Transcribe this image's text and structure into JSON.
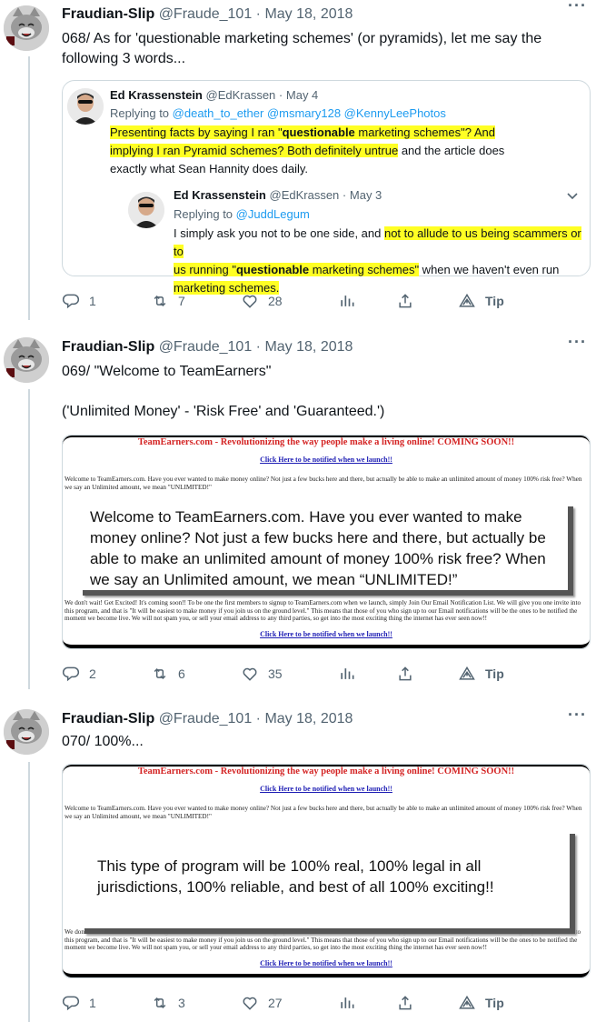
{
  "tweets": [
    {
      "author_name": "Fraudian-Slip",
      "author_handle": "@Fraude_101",
      "separator": "·",
      "date": "May 18, 2018",
      "more_label": "···",
      "text": "068/ As for 'questionable marketing schemes' (or pyramids), let me say the following 3 words...",
      "quote": {
        "author_name": "Ed Krassenstein",
        "author_handle": "@EdKrassen",
        "date": "May 4",
        "replying_prefix": "Replying to",
        "replying_to": "@death_to_ether @msmary128 @KennyLeePhotos",
        "text_hl_1a": "Presenting facts by saying I ran \"",
        "text_hl_1b": "questionable",
        "text_hl_1c": " marketing schemes\"? And",
        "text_hl_2": "implying I ran Pyramid schemes?  Both definitely untrue",
        "text_2_rest": " and the article does",
        "text_3": "exactly what Sean Hannity does daily.",
        "nested": {
          "author_name": "Ed Krassenstein",
          "author_handle": "@EdKrassen",
          "date": "May 3",
          "replying_prefix": "Replying to",
          "replying_to": "@JuddLegum",
          "text_1a": "I simply ask you not to be one side, and ",
          "text_1b": "not to allude to us being scammers or to",
          "text_2a": "us running \"",
          "text_2b": "questionable",
          "text_2c": " marketing schemes\"",
          "text_2d": " when we haven't even run",
          "text_3": "marketing schemes."
        }
      },
      "replies": "1",
      "retweets": "7",
      "likes": "28",
      "tip_label": "Tip"
    },
    {
      "author_name": "Fraudian-Slip",
      "author_handle": "@Fraude_101",
      "separator": "·",
      "date": "May 18, 2018",
      "more_label": "···",
      "text_line1": "069/ \"Welcome to TeamEarners\"",
      "text_line2": "('Unlimited Money' - 'Risk Free' and 'Guaranteed.')",
      "image": {
        "site_title": "TeamEarners.com - Revolutionizing the way people make a living online! COMING SOON!!",
        "site_link": "Click Here to be notified when we launch!!",
        "site_intro": "Welcome to TeamEarners.com. Have you ever wanted to make money online? Not just a few bucks here and there, but actually be able to make an unlimited amount of money 100% risk free? When we say an Unlimited amount, we mean \"UNLIMITED!\"",
        "site_bottom": "We don't wait! Get Excited! It's coming soon!! To be one the first members to signup to TeamEarners.com when we launch, simply Join Our Email Notification List. We will give you one invite into this program, and that is \"It will be easiest to make money if you join us on the ground level.\" This means that those of you who sign up to our Email notifications will be the ones to be notified the moment we become live. We will not spam you, or sell your email address to any third parties, so get into the most exciting thing the internet has ever seen now!!",
        "site_link_bottom": "Click Here to be notified when we launch!!",
        "popup_text": "Welcome to TeamEarners.com. Have you ever wanted to make money online? Not just a few bucks here and there, but actually be able to make an unlimited amount of money 100% risk free? When we say an Unlimited amount, we mean “UNLIMITED!”"
      },
      "replies": "2",
      "retweets": "6",
      "likes": "35",
      "tip_label": "Tip"
    },
    {
      "author_name": "Fraudian-Slip",
      "author_handle": "@Fraude_101",
      "separator": "·",
      "date": "May 18, 2018",
      "more_label": "···",
      "text": "070/ 100%...",
      "image": {
        "site_title": "TeamEarners.com - Revolutionizing the way people make a living online! COMING SOON!!",
        "site_link": "Click Here to be notified when we launch!!",
        "site_intro": "Welcome to TeamEarners.com. Have you ever wanted to make money online? Not just a few bucks here and there, but actually be able to make an unlimited amount of money 100% risk free? When we say an Unlimited amount, we mean \"UNLIMITED!\"",
        "site_bottom": "We don't wait! Get Excited! It's coming soon!! To be one the first members to signup to TeamEarners.com when we launch, simply Join Our Email Notification List. We will give you one invite into this program, and that is \"It will be easiest to make money if you join us on the ground level.\" This means that those of you who sign up to our Email notifications will be the ones to be notified the moment we become live. We will not spam you, or sell your email address to any third parties, so get into the most exciting thing the internet has ever seen now!!",
        "site_link_bottom": "Click Here to be notified when we launch!!",
        "popup_text": "This type of program will be 100% real, 100% legal in all jurisdictions, 100% reliable, and best of all 100% exciting!!"
      },
      "replies": "1",
      "retweets": "3",
      "likes": "27",
      "tip_label": "Tip"
    }
  ],
  "icons": {
    "reply": "reply-icon",
    "retweet": "retweet-icon",
    "like": "heart-icon",
    "analytics": "analytics-icon",
    "share": "share-icon",
    "tip": "tip-icon",
    "chevron": "chevron-down-icon"
  },
  "colors": {
    "link": "#1d9bf0",
    "highlight": "#ffff24",
    "muted": "#536471",
    "site_title": "#d42424"
  }
}
